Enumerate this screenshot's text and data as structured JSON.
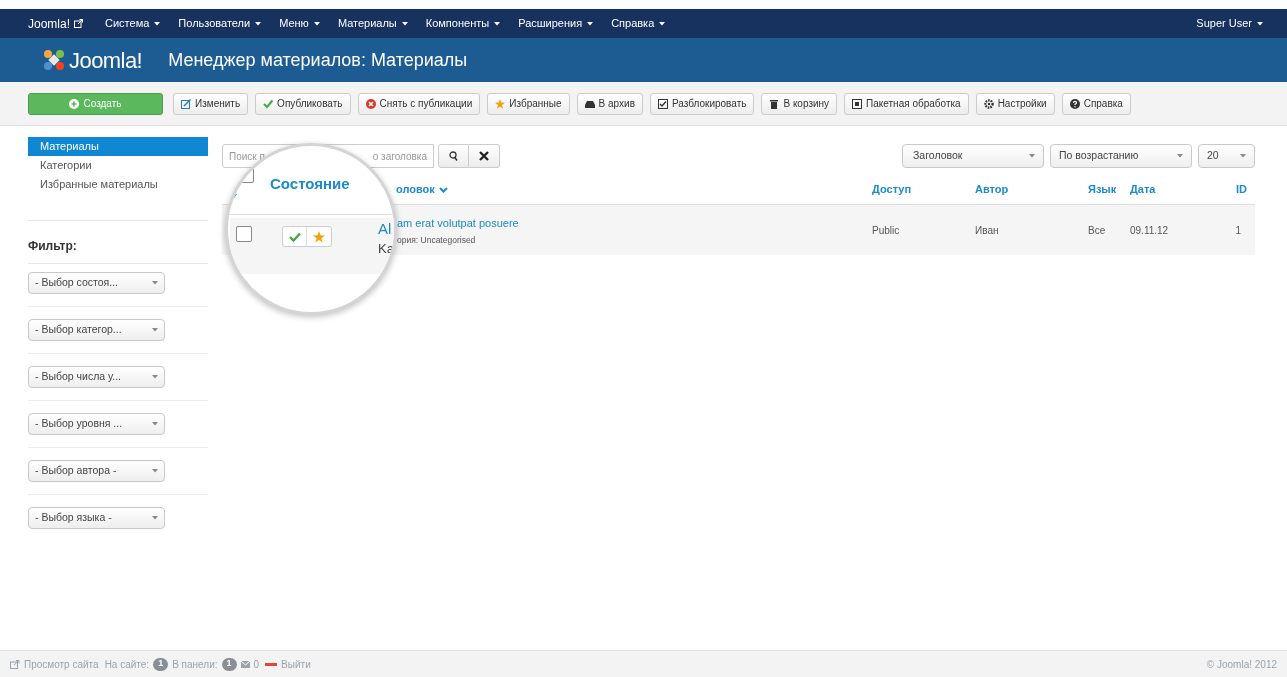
{
  "topbar": {
    "brand": "Joomla!",
    "menus": [
      {
        "label": "Система"
      },
      {
        "label": "Пользователи"
      },
      {
        "label": "Меню"
      },
      {
        "label": "Материалы"
      },
      {
        "label": "Компоненты"
      },
      {
        "label": "Расширения"
      },
      {
        "label": "Справка"
      }
    ],
    "user": "Super User"
  },
  "header": {
    "logo": "Joomla!",
    "title": "Менеджер материалов: Материалы"
  },
  "toolbar": [
    {
      "kind": "create",
      "label": "Создать"
    },
    {
      "kind": "edit",
      "label": "Изменить"
    },
    {
      "kind": "publish",
      "label": "Опубликовать"
    },
    {
      "kind": "unpublish",
      "label": "Снять с публикации"
    },
    {
      "kind": "featured",
      "label": "Избранные"
    },
    {
      "kind": "archive",
      "label": "В архив"
    },
    {
      "kind": "checkin",
      "label": "Разблокировать"
    },
    {
      "kind": "trash",
      "label": "В корзину"
    },
    {
      "kind": "batch",
      "label": "Пакетная обработка"
    },
    {
      "kind": "options",
      "label": "Настройки"
    },
    {
      "kind": "help",
      "label": "Справка"
    }
  ],
  "sidebar": {
    "items": [
      {
        "label": "Материалы",
        "selected": true
      },
      {
        "label": "Категории",
        "selected": false
      },
      {
        "label": "Избранные материалы",
        "selected": false
      }
    ],
    "filter_title": "Фильтр:",
    "filters": [
      "- Выбор состоя...",
      "- Выбор категор...",
      "- Выбор числа у...",
      "- Выбор уровня ...",
      "- Выбор автора -",
      "- Выбор языка -"
    ]
  },
  "search": {
    "placeholder_start": "Поиск п",
    "placeholder_end": "о заголовка"
  },
  "sort": {
    "field": "Заголовок",
    "direction": "По возрастанию",
    "limit": "20"
  },
  "magnifier": {
    "header_checked": false,
    "row_checked": false,
    "column": "Состояние",
    "published": true,
    "featured": true,
    "title_part": "Al",
    "category_part": "Ka"
  },
  "table": {
    "columns": [
      "оловок",
      "Доступ",
      "Автор",
      "Язык",
      "Дата",
      "ID"
    ],
    "rows": [
      {
        "title": "am erat volutpat posuere",
        "category": "ория: Uncategorised",
        "access": "Public",
        "author": "Иван",
        "language": "Все",
        "date": "09.11.12",
        "id": "1"
      }
    ]
  },
  "status_bar": {
    "view_site": "Просмотр сайта",
    "on_site": "На сайте:",
    "on_site_count": "1",
    "in_panel": "В панели:",
    "in_panel_count": "1",
    "messages": "0",
    "logout": "Выйти",
    "copyright": "© Joomla! 2012"
  }
}
